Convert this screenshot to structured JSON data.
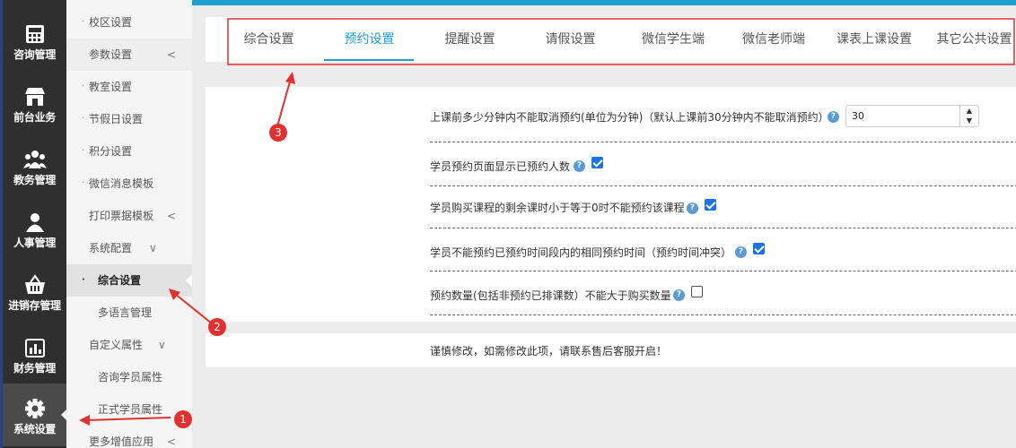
{
  "main_nav": [
    {
      "label": "咨询管理",
      "icon": "calculator-icon"
    },
    {
      "label": "前台业务",
      "icon": "storefront-icon"
    },
    {
      "label": "教务管理",
      "icon": "group-icon"
    },
    {
      "label": "人事管理",
      "icon": "person-icon"
    },
    {
      "label": "进销存管理",
      "icon": "basket-icon"
    },
    {
      "label": "财务管理",
      "icon": "chart-icon"
    },
    {
      "label": "系统设置",
      "icon": "gear-icon",
      "active": true
    }
  ],
  "sub_nav": [
    {
      "label": "校区设置"
    },
    {
      "label": "参数设置",
      "chevron": "<"
    },
    {
      "label": "教室设置"
    },
    {
      "label": "节假日设置"
    },
    {
      "label": "积分设置"
    },
    {
      "label": "微信消息模板"
    },
    {
      "label": "打印票据模板",
      "chevron": "<"
    },
    {
      "label": "系统配置",
      "chevron": "∨"
    },
    {
      "label": "综合设置",
      "selected": true
    },
    {
      "label": "多语言管理"
    },
    {
      "label": "自定义属性",
      "chevron": "∨"
    },
    {
      "label": "咨询学员属性"
    },
    {
      "label": "正式学员属性"
    },
    {
      "label": "更多增值应用",
      "chevron": "<"
    }
  ],
  "tabs": [
    {
      "label": "综合设置"
    },
    {
      "label": "预约设置",
      "active": true
    },
    {
      "label": "提醒设置"
    },
    {
      "label": "请假设置"
    },
    {
      "label": "微信学生端"
    },
    {
      "label": "微信老师端"
    },
    {
      "label": "课表上课设置"
    },
    {
      "label": "其它公共设置"
    }
  ],
  "settings": {
    "cancel_limit": {
      "label": "上课前多少分钟内不能取消预约(单位为分钟)（默认上课前30分钟内不能取消预约）",
      "value": "30"
    },
    "show_booked_count": {
      "label": "学员预约页面显示已预约人数",
      "checked": true
    },
    "zero_remaining_block": {
      "label": "学员购买课程的剩余课时小于等于0时不能预约该课程",
      "checked": true
    },
    "time_conflict_block": {
      "label": "学员不能预约已预约时间段内的相同预约时间（预约时间冲突）",
      "checked": true
    },
    "quantity_limit": {
      "label": "预约数量(包括非预约已排课数）不能大于购买数量",
      "checked": false
    }
  },
  "notice": "谨慎修改，如需修改此项，请联系售后客服开启！",
  "annotations": [
    "1",
    "2",
    "3"
  ],
  "colors": {
    "accent": "#1e9fd1",
    "annotation": "#e03030",
    "sidebar": "#2f2f2f"
  },
  "spin": {
    "up": "▲",
    "down": "▼"
  },
  "help_glyph": "?"
}
